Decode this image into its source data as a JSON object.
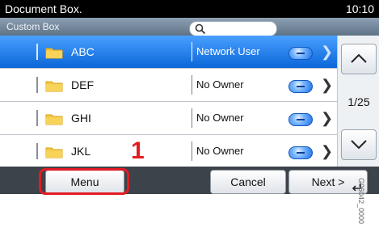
{
  "header": {
    "title": "Document Box.",
    "time": "10:10"
  },
  "subheader": {
    "label": "Custom Box",
    "search_placeholder": ""
  },
  "list": {
    "rows": [
      {
        "name": "ABC",
        "owner": "Network User",
        "selected": true
      },
      {
        "name": "DEF",
        "owner": "No Owner",
        "selected": false
      },
      {
        "name": "GHI",
        "owner": "No Owner",
        "selected": false
      },
      {
        "name": "JKL",
        "owner": "No Owner",
        "selected": false
      }
    ]
  },
  "pager": {
    "page": "1/25"
  },
  "buttons": {
    "menu": "Menu",
    "cancel": "Cancel",
    "next": "Next >"
  },
  "annotation": {
    "callout_number": "1",
    "side_code": "G06042_0000"
  },
  "colors": {
    "selected_row": "#0b66d8",
    "highlight": "#e31b23"
  }
}
